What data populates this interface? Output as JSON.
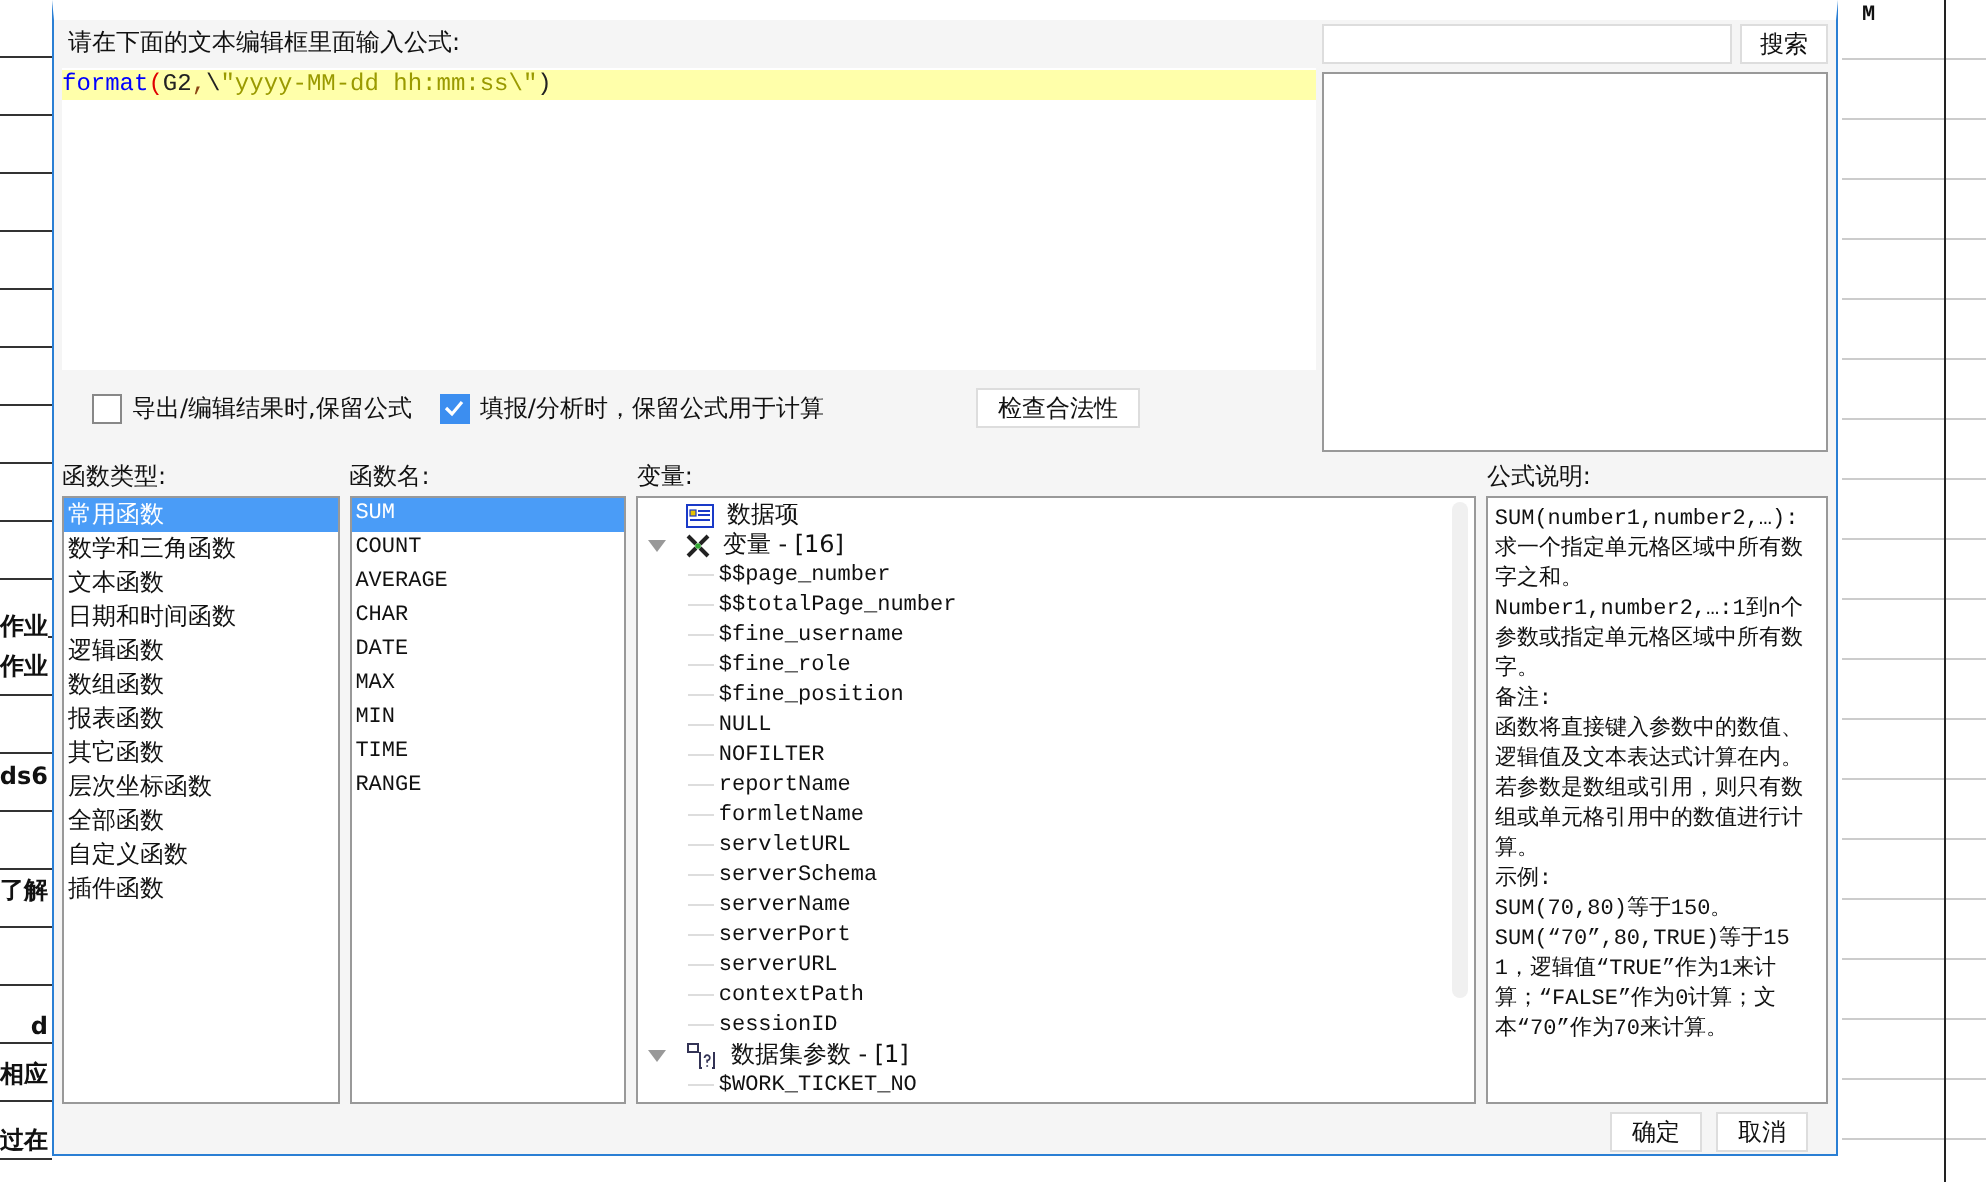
{
  "sheet": {
    "column_header": "M",
    "fragments": [
      "作业",
      "作业",
      "ds6",
      "了解",
      "d",
      "相应",
      "过在"
    ]
  },
  "dialog": {
    "prompt": "请在下面的文本编辑框里面输入公式:",
    "formula": [
      {
        "text": "format",
        "kind": "function"
      },
      {
        "text": "(",
        "kind": "paren"
      },
      {
        "text": "G2",
        "kind": "plain"
      },
      {
        "text": ",",
        "kind": "comma"
      },
      {
        "text": "\\",
        "kind": "plain"
      },
      {
        "text": "\"yyyy-MM-dd hh:mm:ss\\\"",
        "kind": "string"
      },
      {
        "text": ")",
        "kind": "plain"
      }
    ],
    "options": [
      {
        "label": "导出/编辑结果时,保留公式",
        "checked": false
      },
      {
        "label": "填报/分析时，保留公式用于计算",
        "checked": true
      }
    ],
    "check_button": "检查合法性",
    "search": {
      "button": "搜索"
    },
    "function_types": {
      "label": "函数类型:",
      "items": [
        {
          "label": "常用函数",
          "selected": true
        },
        {
          "label": "数学和三角函数",
          "selected": false
        },
        {
          "label": "文本函数",
          "selected": false
        },
        {
          "label": "日期和时间函数",
          "selected": false
        },
        {
          "label": "逻辑函数",
          "selected": false
        },
        {
          "label": "数组函数",
          "selected": false
        },
        {
          "label": "报表函数",
          "selected": false
        },
        {
          "label": "其它函数",
          "selected": false
        },
        {
          "label": "层次坐标函数",
          "selected": false
        },
        {
          "label": "全部函数",
          "selected": false
        },
        {
          "label": "自定义函数",
          "selected": false
        },
        {
          "label": "插件函数",
          "selected": false
        }
      ]
    },
    "function_names": {
      "label": "函数名:",
      "items": [
        {
          "label": "SUM",
          "selected": true
        },
        {
          "label": "COUNT",
          "selected": false
        },
        {
          "label": "AVERAGE",
          "selected": false
        },
        {
          "label": "CHAR",
          "selected": false
        },
        {
          "label": "DATE",
          "selected": false
        },
        {
          "label": "MAX",
          "selected": false
        },
        {
          "label": "MIN",
          "selected": false
        },
        {
          "label": "TIME",
          "selected": false
        },
        {
          "label": "RANGE",
          "selected": false
        }
      ]
    },
    "variables": {
      "label": "变量:",
      "tree": [
        {
          "label": "数据项",
          "kind": "data"
        },
        {
          "label": "变量 - [16]",
          "kind": "variable",
          "expanded": true,
          "children": [
            {
              "label": "$$page_number"
            },
            {
              "label": "$$totalPage_number"
            },
            {
              "label": "$fine_username"
            },
            {
              "label": "$fine_role"
            },
            {
              "label": "$fine_position"
            },
            {
              "label": "NULL"
            },
            {
              "label": "NOFILTER"
            },
            {
              "label": "reportName"
            },
            {
              "label": "formletName"
            },
            {
              "label": "servletURL"
            },
            {
              "label": "serverSchema"
            },
            {
              "label": "serverName"
            },
            {
              "label": "serverPort"
            },
            {
              "label": "serverURL"
            },
            {
              "label": "contextPath"
            },
            {
              "label": "sessionID"
            }
          ]
        },
        {
          "label": "数据集参数 - [1]",
          "kind": "parameter",
          "expanded": true,
          "children": [
            {
              "label": "$WORK_TICKET_NO"
            }
          ]
        }
      ]
    },
    "description": {
      "label": "公式说明:",
      "paragraphs": [
        "SUM(number1,number2,…):求一个指定单元格区域中所有数字之和。",
        "Number1,number2,…:1到n个参数或指定单元格区域中所有数字。",
        "备注:",
        "函数将直接键入参数中的数值、逻辑值及文本表达式计算在内。若参数是数组或引用，则只有数组或单元格引用中的数值进行计算。",
        "示例:",
        "SUM(70,80)等于150。",
        "SUM(“70”,80,TRUE)等于151，逻辑值“TRUE”作为1来计算；“FALSE”作为0计算；文本“70”作为70来计算。"
      ]
    },
    "buttons": [
      "确定",
      "取消"
    ]
  }
}
